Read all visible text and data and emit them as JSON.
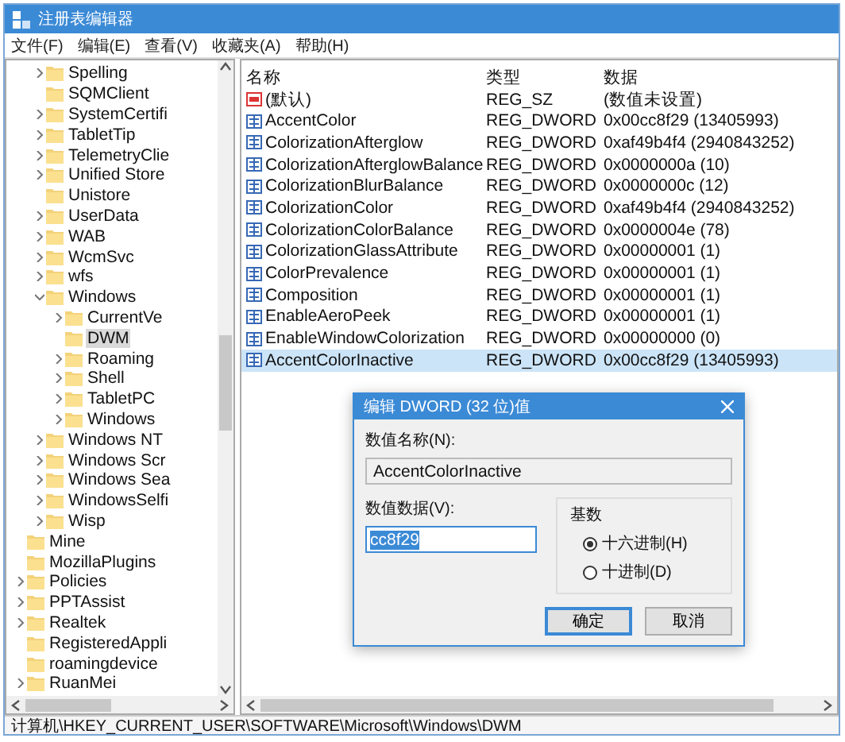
{
  "window": {
    "title": "注册表编辑器"
  },
  "menu": [
    "文件(F)",
    "编辑(E)",
    "查看(V)",
    "收藏夹(A)",
    "帮助(H)"
  ],
  "tree": {
    "items": [
      {
        "kind": "continued",
        "children": [
          {
            "label": "Spelling",
            "expandable": true,
            "expanded": false,
            "selected": false
          },
          {
            "label": "SQMClient",
            "expandable": false,
            "selected": false
          },
          {
            "label": "SystemCertifi",
            "expandable": true,
            "expanded": false,
            "selected": false
          },
          {
            "label": "TabletTip",
            "expandable": true,
            "expanded": false,
            "selected": false
          },
          {
            "label": "TelemetryClie",
            "expandable": true,
            "expanded": false,
            "selected": false
          },
          {
            "label": "Unified Store",
            "expandable": true,
            "expanded": false,
            "selected": false
          },
          {
            "label": "Unistore",
            "expandable": false,
            "selected": false
          },
          {
            "label": "UserData",
            "expandable": true,
            "expanded": false,
            "selected": false
          },
          {
            "label": "WAB",
            "expandable": true,
            "expanded": false,
            "selected": false
          },
          {
            "label": "WcmSvc",
            "expandable": true,
            "expanded": false,
            "selected": false
          },
          {
            "label": "wfs",
            "expandable": true,
            "expanded": false,
            "selected": false
          },
          {
            "label": "Windows",
            "expandable": true,
            "expanded": true,
            "selected": false,
            "children": [
              {
                "label": "CurrentVe",
                "expandable": true,
                "expanded": false,
                "selected": false
              },
              {
                "label": "DWM",
                "expandable": false,
                "selected": true
              },
              {
                "label": "Roaming",
                "expandable": true,
                "expanded": false,
                "selected": false
              },
              {
                "label": "Shell",
                "expandable": true,
                "expanded": false,
                "selected": false
              },
              {
                "label": "TabletPC",
                "expandable": true,
                "expanded": false,
                "selected": false
              },
              {
                "label": "Windows",
                "expandable": true,
                "expanded": false,
                "selected": false
              }
            ]
          },
          {
            "label": "Windows NT",
            "expandable": true,
            "expanded": false,
            "selected": false
          },
          {
            "label": "Windows Scr",
            "expandable": true,
            "expanded": false,
            "selected": false
          },
          {
            "label": "Windows Sea",
            "expandable": true,
            "expanded": false,
            "selected": false
          },
          {
            "label": "WindowsSelfi",
            "expandable": true,
            "expanded": false,
            "selected": false
          },
          {
            "label": "Wisp",
            "expandable": true,
            "expanded": false,
            "selected": false
          }
        ]
      },
      {
        "label": "Mine",
        "expandable": false,
        "selected": false
      },
      {
        "label": "MozillaPlugins",
        "expandable": false,
        "selected": false
      },
      {
        "label": "Policies",
        "expandable": true,
        "expanded": false,
        "selected": false
      },
      {
        "label": "PPTAssist",
        "expandable": true,
        "expanded": false,
        "selected": false
      },
      {
        "label": "Realtek",
        "expandable": true,
        "expanded": false,
        "selected": false
      },
      {
        "label": "RegisteredAppli",
        "expandable": false,
        "selected": false
      },
      {
        "label": "roamingdevice",
        "expandable": false,
        "selected": false
      },
      {
        "label": "RuanMei",
        "expandable": true,
        "expanded": false,
        "selected": false
      }
    ]
  },
  "values": {
    "columns": [
      "名称",
      "类型",
      "数据"
    ],
    "rows": [
      {
        "kind": "string",
        "name": "(默认)",
        "type": "REG_SZ",
        "data": "(数值未设置)",
        "selected": false
      },
      {
        "kind": "binary",
        "name": "AccentColor",
        "type": "REG_DWORD",
        "data": "0x00cc8f29 (13405993)",
        "selected": false
      },
      {
        "kind": "binary",
        "name": "ColorizationAfterglow",
        "type": "REG_DWORD",
        "data": "0xaf49b4f4 (2940843252)",
        "selected": false
      },
      {
        "kind": "binary",
        "name": "ColorizationAfterglowBalance",
        "type": "REG_DWORD",
        "data": "0x0000000a (10)",
        "selected": false
      },
      {
        "kind": "binary",
        "name": "ColorizationBlurBalance",
        "type": "REG_DWORD",
        "data": "0x0000000c (12)",
        "selected": false
      },
      {
        "kind": "binary",
        "name": "ColorizationColor",
        "type": "REG_DWORD",
        "data": "0xaf49b4f4 (2940843252)",
        "selected": false
      },
      {
        "kind": "binary",
        "name": "ColorizationColorBalance",
        "type": "REG_DWORD",
        "data": "0x0000004e (78)",
        "selected": false
      },
      {
        "kind": "binary",
        "name": "ColorizationGlassAttribute",
        "type": "REG_DWORD",
        "data": "0x00000001 (1)",
        "selected": false
      },
      {
        "kind": "binary",
        "name": "ColorPrevalence",
        "type": "REG_DWORD",
        "data": "0x00000001 (1)",
        "selected": false
      },
      {
        "kind": "binary",
        "name": "Composition",
        "type": "REG_DWORD",
        "data": "0x00000001 (1)",
        "selected": false
      },
      {
        "kind": "binary",
        "name": "EnableAeroPeek",
        "type": "REG_DWORD",
        "data": "0x00000001 (1)",
        "selected": false
      },
      {
        "kind": "binary",
        "name": "EnableWindowColorization",
        "type": "REG_DWORD",
        "data": "0x00000000 (0)",
        "selected": false
      },
      {
        "kind": "binary",
        "name": "AccentColorInactive",
        "type": "REG_DWORD",
        "data": "0x00cc8f29 (13405993)",
        "selected": true
      }
    ]
  },
  "dialog": {
    "title": "编辑 DWORD (32 位)值",
    "name_label": "数值名称(N):",
    "name_value": "AccentColorInactive",
    "data_label": "数值数据(V):",
    "data_value": "cc8f29",
    "data_selected": true,
    "base_label": "基数",
    "bases": [
      {
        "label": "十六进制(H)",
        "selected": true
      },
      {
        "label": "十进制(D)",
        "selected": false
      }
    ],
    "buttons": [
      {
        "label": "确定",
        "default": true
      },
      {
        "label": "取消",
        "default": false
      }
    ]
  },
  "status_bar": "计算机\\HKEY_CURRENT_USER\\SOFTWARE\\Microsoft\\Windows\\DWM"
}
